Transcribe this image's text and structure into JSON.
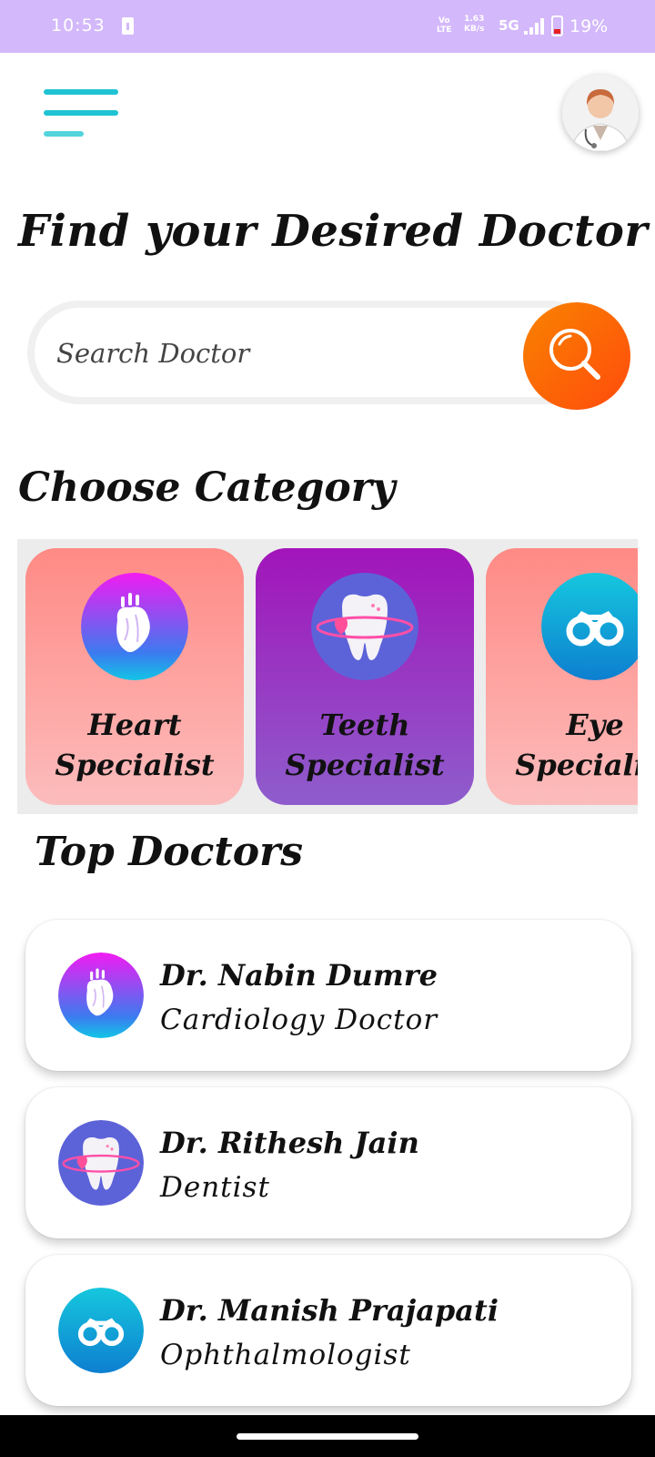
{
  "status_bar": {
    "time": "10:53",
    "volte": "VoLTE",
    "speed_value": "1.63",
    "speed_unit": "KB/s",
    "network": "5G",
    "battery_percent": "19%"
  },
  "header": {
    "menu_icon": "hamburger-menu-icon",
    "avatar_icon": "doctor-avatar"
  },
  "title": "Find your Desired Doctor",
  "search": {
    "placeholder": "Search Doctor",
    "button_icon": "search-icon"
  },
  "categories_title": "Choose Category",
  "categories": [
    {
      "label": "Heart\nSpecialist",
      "icon": "heart-icon"
    },
    {
      "label": "Teeth\nSpecialist",
      "icon": "tooth-icon"
    },
    {
      "label": "Eye\nSpecialist",
      "icon": "binoculars-icon"
    }
  ],
  "top_doctors_title": "Top Doctors",
  "doctors": [
    {
      "name": "Dr. Nabin Dumre",
      "specialty": "Cardiology Doctor",
      "icon": "heart-icon"
    },
    {
      "name": "Dr. Rithesh Jain",
      "specialty": "Dentist",
      "icon": "tooth-icon"
    },
    {
      "name": "Dr. Manish Prajapati",
      "specialty": "Ophthalmologist",
      "icon": "binoculars-icon"
    }
  ],
  "colors": {
    "status_bar": "#d3b8fb",
    "menu_accent": "#1fc3d3",
    "search_button": "#ff6a00",
    "card_pink": "#ff8a85",
    "card_purple": "#a214ba"
  }
}
